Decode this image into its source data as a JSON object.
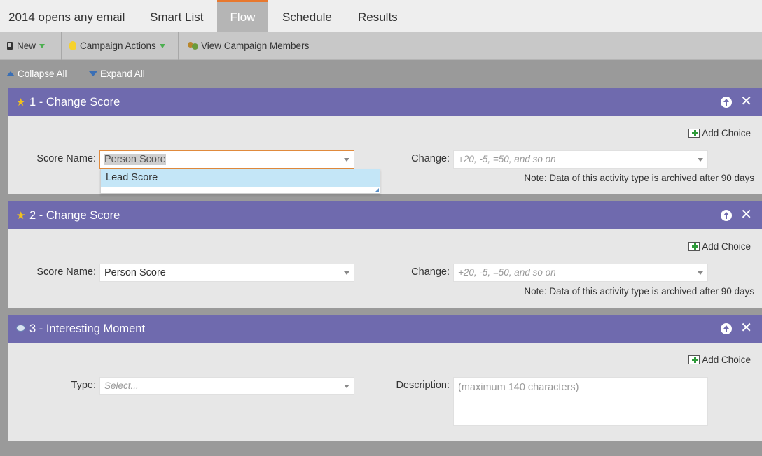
{
  "tabs": {
    "campaign_title": "2014 opens any email",
    "items": [
      {
        "label": "Smart List"
      },
      {
        "label": "Flow"
      },
      {
        "label": "Schedule"
      },
      {
        "label": "Results"
      }
    ],
    "active": "Flow",
    "active_accent_color": "#e8782e"
  },
  "toolbar": {
    "new_label": "New",
    "campaign_actions_label": "Campaign Actions",
    "view_members_label": "View Campaign Members"
  },
  "collapse_bar": {
    "collapse_label": "Collapse All",
    "expand_label": "Expand All"
  },
  "header_color": "#6f6aae",
  "steps": [
    {
      "title": "1 - Change Score",
      "icon": "star-icon",
      "add_choice_label": "Add Choice",
      "left_label": "Score Name:",
      "left_value": "Person Score",
      "right_label": "Change:",
      "right_placeholder": "+20, -5, =50, and so on",
      "note": "Note: Data of this activity type is archived after 90 days",
      "dropdown_options": [
        "Lead Score"
      ]
    },
    {
      "title": "2 - Change Score",
      "icon": "star-icon",
      "add_choice_label": "Add Choice",
      "left_label": "Score Name:",
      "left_value": "Person Score",
      "right_label": "Change:",
      "right_placeholder": "+20, -5, =50, and so on",
      "note": "Note: Data of this activity type is archived after 90 days"
    },
    {
      "title": "3 - Interesting Moment",
      "icon": "speech-bubble-icon",
      "add_choice_label": "Add Choice",
      "left_label": "Type:",
      "left_placeholder": "Select...",
      "right_label": "Description:",
      "right_placeholder": "(maximum 140 characters)"
    }
  ]
}
